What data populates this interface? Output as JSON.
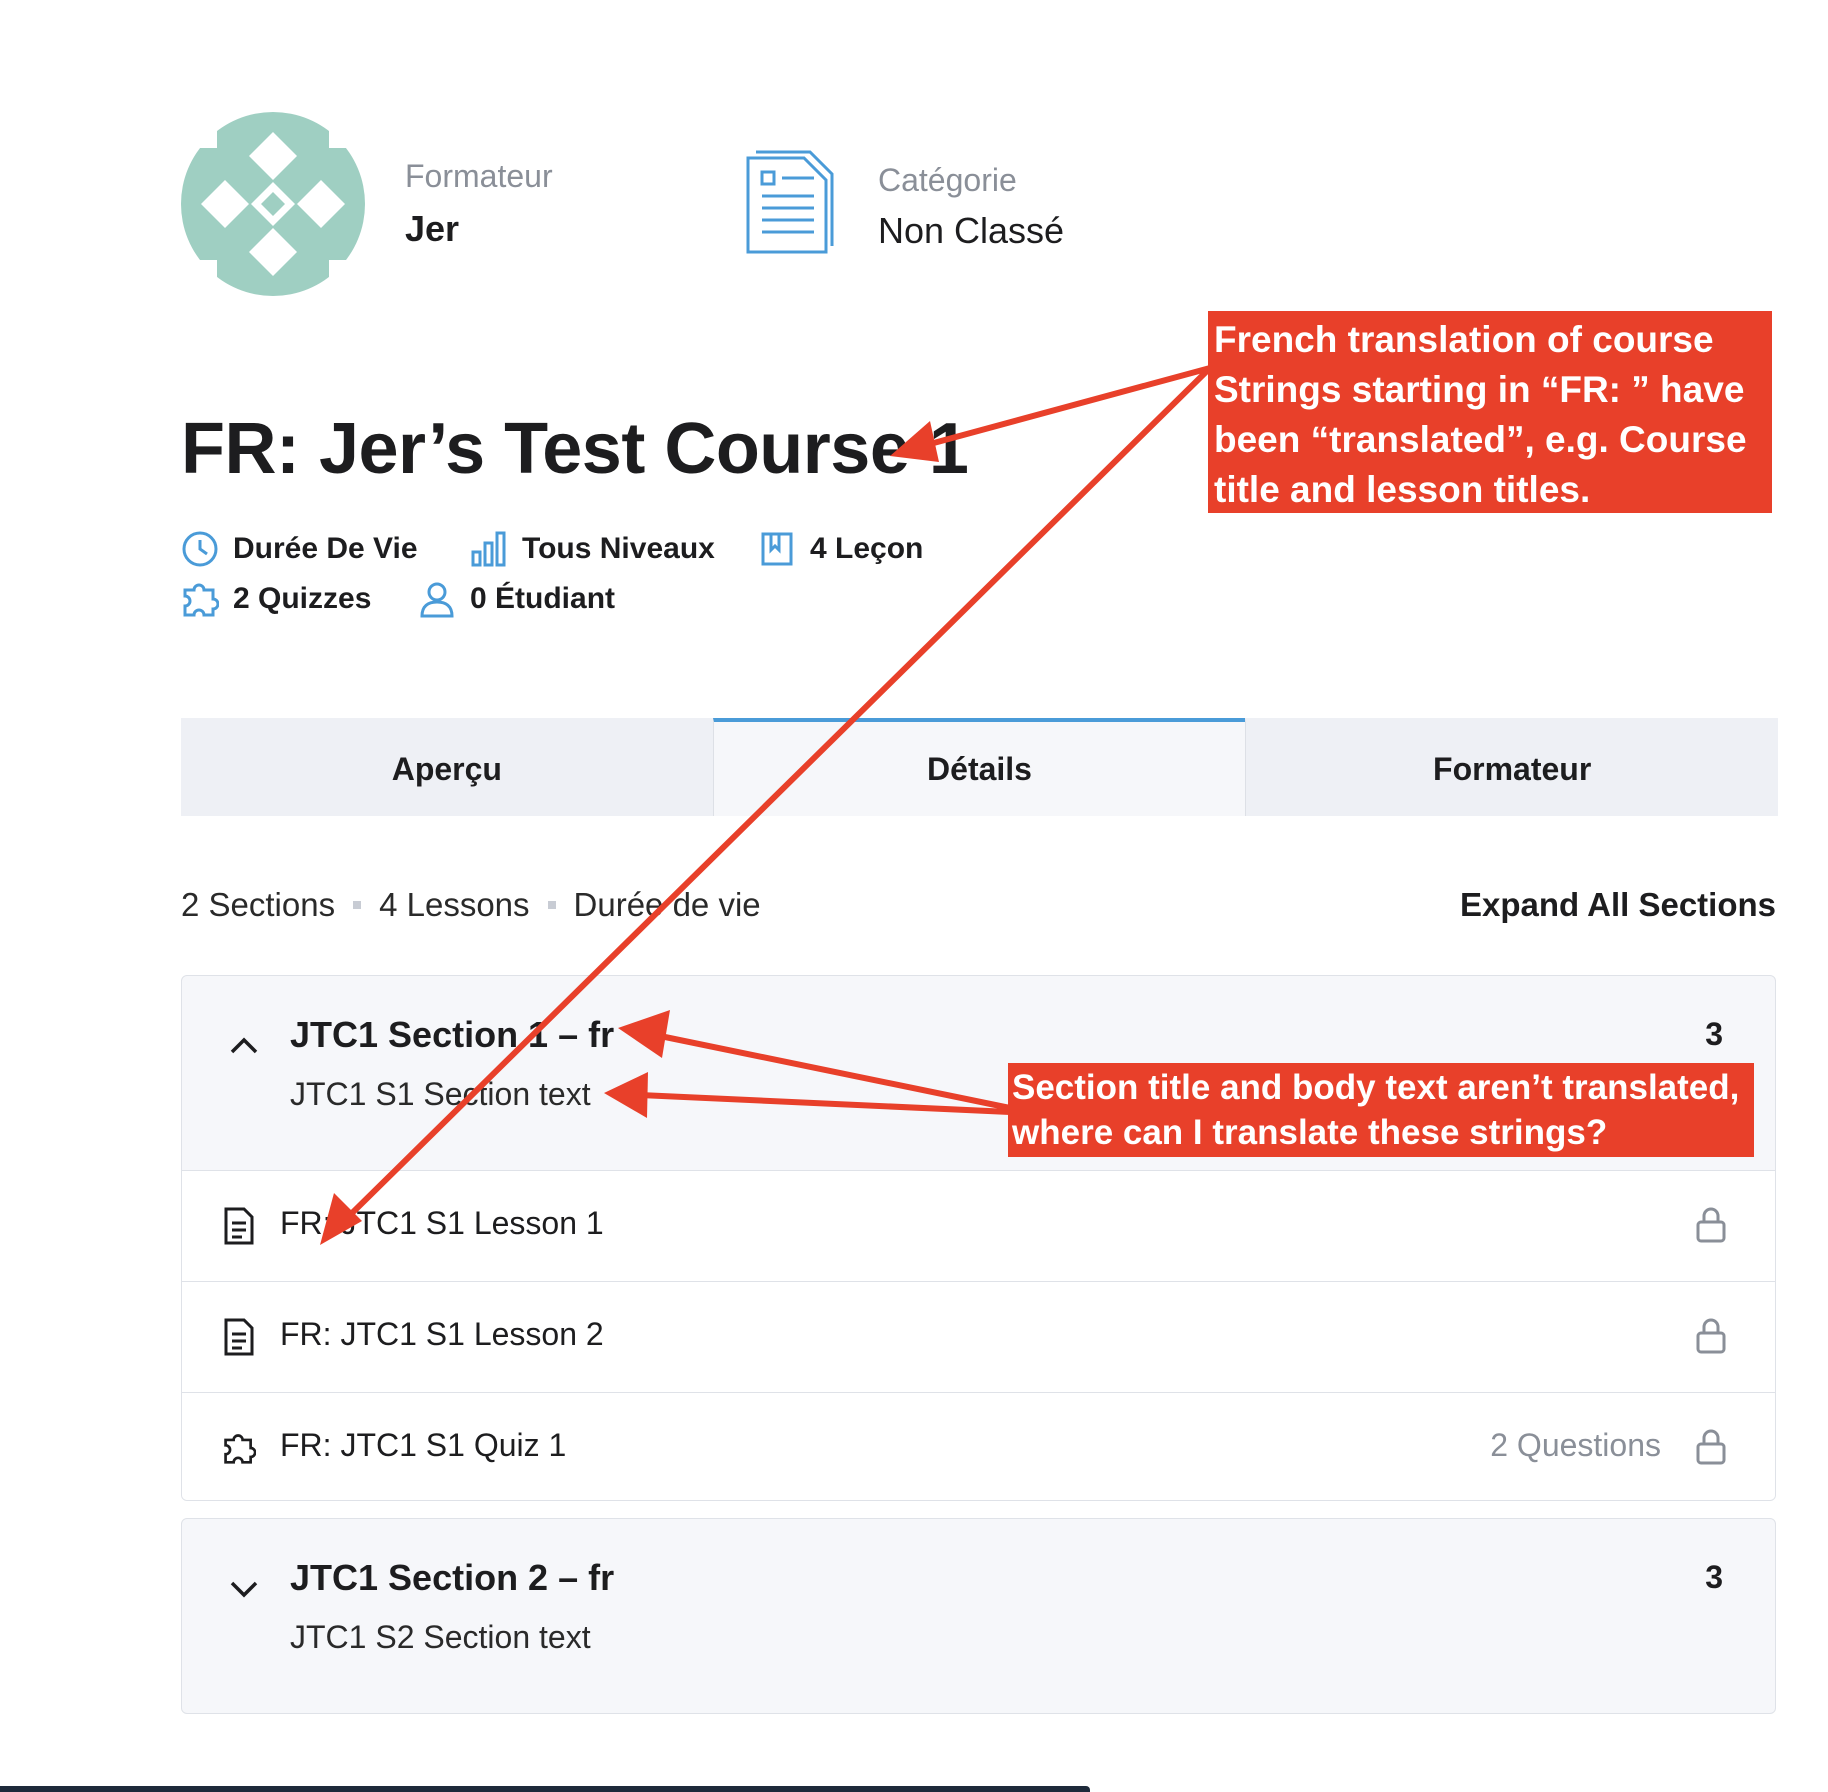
{
  "header": {
    "instructor_label": "Formateur",
    "instructor_name": "Jer",
    "category_label": "Catégorie",
    "category_value": "Non Classé"
  },
  "course": {
    "title": "FR: Jer’s Test Course 1",
    "stats": {
      "duration": "Durée De Vie",
      "level": "Tous Niveaux",
      "lessons": "4 Leçon",
      "quizzes": "2 Quizzes",
      "students": "0 Étudiant"
    }
  },
  "tabs": [
    {
      "label": "Aperçu",
      "active": false
    },
    {
      "label": "Détails",
      "active": true
    },
    {
      "label": "Formateur",
      "active": false
    }
  ],
  "curriculum": {
    "summary": {
      "sections": "2 Sections",
      "lessons": "4 Lessons",
      "duration": "Durée de vie"
    },
    "expand_all_label": "Expand All Sections",
    "sections": [
      {
        "title": "JTC1 Section 1 – fr",
        "description": "JTC1 S1 Section text",
        "count": "3",
        "expanded": true,
        "items": [
          {
            "icon": "document-icon",
            "title": "FR: JTC1 S1 Lesson 1",
            "meta": ""
          },
          {
            "icon": "document-icon",
            "title": "FR: JTC1 S1 Lesson 2",
            "meta": ""
          },
          {
            "icon": "puzzle-icon",
            "title": "FR: JTC1 S1 Quiz 1",
            "meta": "2 Questions"
          }
        ]
      },
      {
        "title": "JTC1 Section 2 – fr",
        "description": "JTC1 S2 Section text",
        "count": "3",
        "expanded": false,
        "items": []
      }
    ]
  },
  "annotations": {
    "note1": "French translation of course Strings starting in “FR: ” have been “translated”, e.g. Course title and lesson titles.",
    "note2": "Section title and body text aren’t translated, where can I translate these strings?"
  },
  "colors": {
    "accent": "#4a9bd8",
    "annotation": "#e8402a",
    "avatar": "#9fcfc2"
  }
}
